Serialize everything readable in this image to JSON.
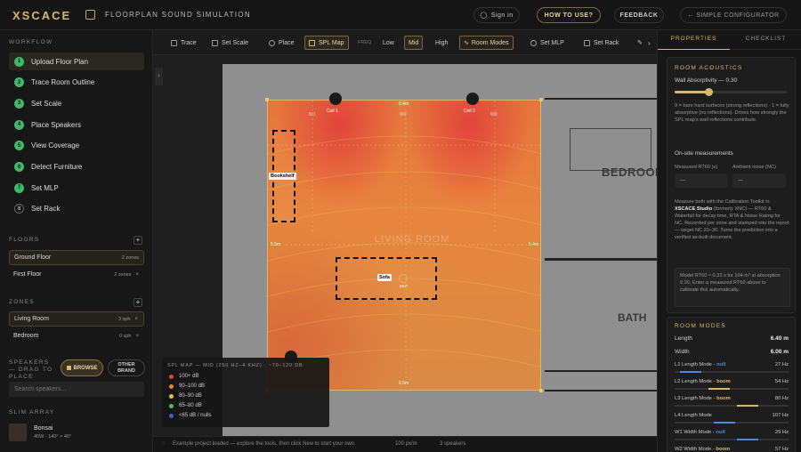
{
  "header": {
    "logo": "XSCACE",
    "title": "FLOORPLAN SOUND SIMULATION",
    "sign_in": "Sign in",
    "how_to": "HOW TO USE?",
    "feedback": "FEEDBACK",
    "simple": "← SIMPLE CONFIGURATOR"
  },
  "sidebar": {
    "workflow_label": "WORKFLOW",
    "steps": [
      {
        "num": "1",
        "label": "Upload Floor Plan"
      },
      {
        "num": "2",
        "label": "Trace Room Outline"
      },
      {
        "num": "3",
        "label": "Set Scale"
      },
      {
        "num": "4",
        "label": "Place Speakers"
      },
      {
        "num": "5",
        "label": "View Coverage"
      },
      {
        "num": "6",
        "label": "Detect Furniture"
      },
      {
        "num": "7",
        "label": "Set MLP"
      },
      {
        "num": "8",
        "label": "Set Rack"
      }
    ],
    "floors_label": "FLOORS",
    "floors": [
      {
        "name": "Ground Floor",
        "meta": "2 zones",
        "x": "×"
      },
      {
        "name": "First Floor",
        "meta": "2 zones",
        "x": "×"
      }
    ],
    "zones_label": "ZONES",
    "zones": [
      {
        "name": "Living Room",
        "meta": "3 sph",
        "x": "×"
      },
      {
        "name": "Bedroom",
        "meta": "0 sph",
        "x": "×"
      }
    ],
    "speakers_label": "SPEAKERS — DRAG TO PLACE",
    "browse": "BROWSE",
    "other_brand": "OTHER BRAND",
    "search_placeholder": "Search speakers...",
    "slim_label": "SLIM ARRAY",
    "product_name": "Bonsai",
    "product_meta": "40W · 140° × 40°",
    "plus": "+"
  },
  "toolbar": {
    "trace": "Trace",
    "set_scale": "Set Scale",
    "place": "Place",
    "spl_map": "SPL Map",
    "freq": "FREQ",
    "low": "Low",
    "mid": "Mid",
    "high": "High",
    "room_modes": "Room Modes",
    "set_mlp": "Set MLP",
    "set_rack": "Set Rack"
  },
  "canvas": {
    "bedroom": "BEDROOM",
    "bath": "BATH",
    "living": "LIVING ROOM",
    "bookshelf": "Bookshelf",
    "sofa": "Sofa",
    "mlp": "MLP",
    "ceil1": "Ceil 1",
    "ceil2": "Ceil 2",
    "w1": "W1",
    "w2": "W2",
    "w3": "W3",
    "top_mark": "0.4m",
    "left_mark": "5.5m",
    "right_mark": "5.4m",
    "bottom_mark": "6.5m",
    "legend": {
      "title": "SPL MAP — MID (250 HZ–4 KHZ) · ~70–120 DB",
      "items": [
        {
          "label": "100+ dB",
          "color": "#e0453a"
        },
        {
          "label": "90–100 dB",
          "color": "#e8823a"
        },
        {
          "label": "80–90 dB",
          "color": "#e6c23a"
        },
        {
          "label": "65–80 dB",
          "color": "#4fbf5a"
        },
        {
          "label": "<65 dB / nulls",
          "color": "#3a62d6"
        }
      ]
    }
  },
  "status": {
    "msg": "Example project loaded — explore the tools, then click New to start your own",
    "scale": "100 px/m",
    "speakers": "3 speakers"
  },
  "right": {
    "tab_properties": "PROPERTIES",
    "tab_checklist": "CHECKLIST",
    "acoustics": {
      "title": "ROOM ACOUSTICS",
      "absorb_label": "Wall Absorptivity — 0.30",
      "absorb_value": 0.3,
      "desc": "0 = bare hard surfaces (strong reflections) · 1 = fully absorptive (no reflections). Drives how strongly the SPL map's wall reflections contribute.",
      "onsite": "On-site measurements",
      "rt60_label": "Measured RT60 (s)",
      "noise_label": "Ambient noise (NC)",
      "rt60_value": "—",
      "noise_value": "—",
      "cal_text_1": "Measure both with the Calibration Toolkit in",
      "cal_studio": "XSCACE Studio",
      "cal_text_2": "(formerly XNC) — RT60 & Waterfall for decay time, RTA & Noise Rating for NC. Recorded per zone and stamped into the report — target NC 20–30. Turns the prediction into a verified as-built document.",
      "model_text": "Model RT60 ≈ 0.33 s for 104 m³ at absorption 0.30. Enter a measured RT60 above to calibrate this automatically."
    },
    "modes": {
      "title": "ROOM MODES",
      "length_label": "Length",
      "length_value": "6.40 m",
      "width_label": "Width",
      "width_value": "6.00 m",
      "list": [
        {
          "label": "L1 Length Mode",
          "tag": "null",
          "hz": "27 Hz",
          "fill": 0.2,
          "color": "#4a8ad8"
        },
        {
          "label": "L2 Length Mode",
          "tag": "boom",
          "hz": "54 Hz",
          "fill": 0.45,
          "color": "#d9b86a"
        },
        {
          "label": "L3 Length Mode",
          "tag": "boom",
          "hz": "80 Hz",
          "fill": 0.7,
          "color": "#d9b86a"
        },
        {
          "label": "L4 Length Mode",
          "tag": "",
          "hz": "107 Hz",
          "fill": 0.5,
          "color": "#4a8ad8"
        },
        {
          "label": "W1 Width Mode",
          "tag": "null",
          "hz": "29 Hz",
          "fill": 0.7,
          "color": "#4a8ad8"
        },
        {
          "label": "W2 Width Mode",
          "tag": "boom",
          "hz": "57 Hz",
          "fill": 0.4,
          "color": "#d9b86a"
        }
      ]
    }
  },
  "colors": {
    "accent": "#d9b86a",
    "green": "#3fb86a"
  }
}
